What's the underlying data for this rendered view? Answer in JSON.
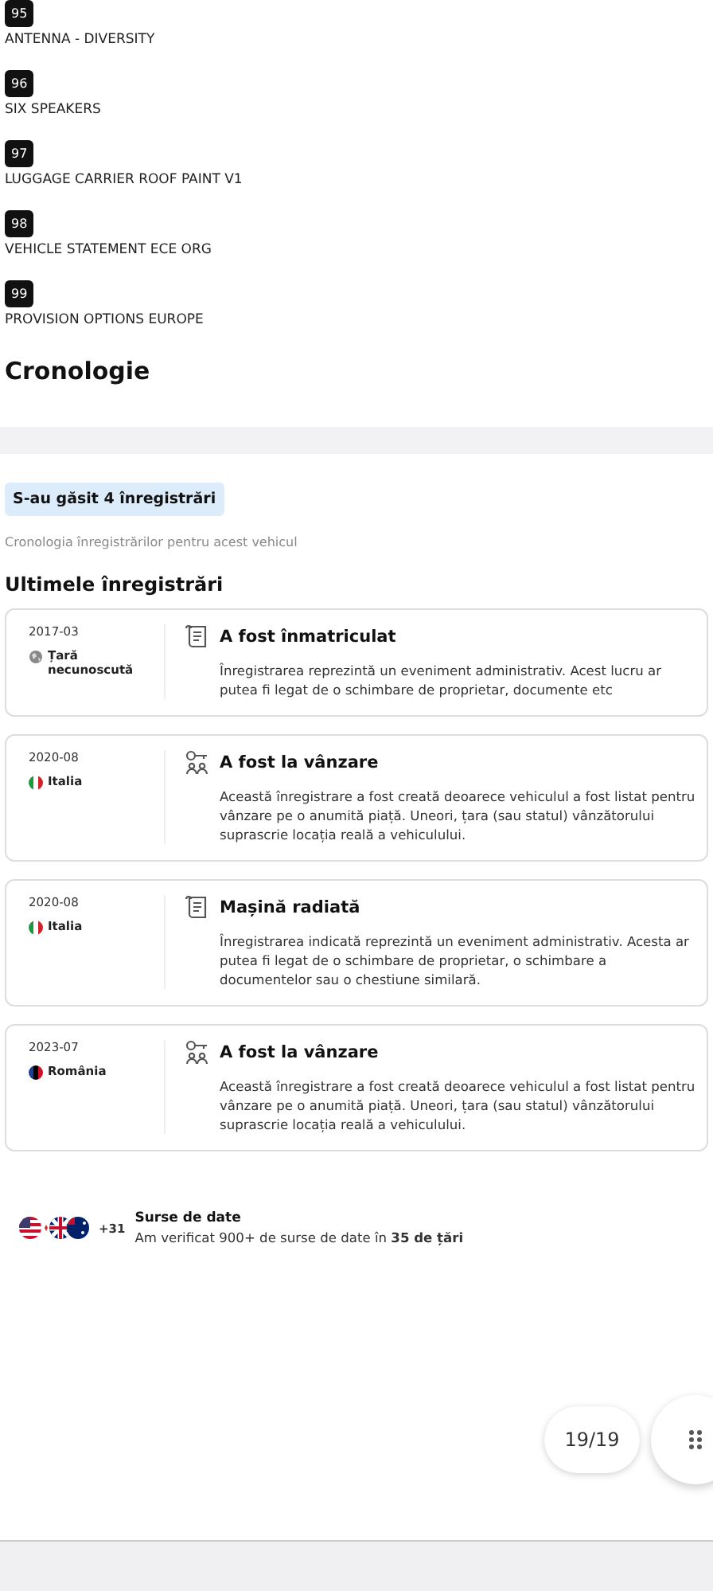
{
  "options": [
    {
      "number": "95",
      "label": "ANTENNA - DIVERSITY"
    },
    {
      "number": "96",
      "label": "SIX SPEAKERS"
    },
    {
      "number": "97",
      "label": "LUGGAGE CARRIER ROOF PAINT V1"
    },
    {
      "number": "98",
      "label": "VEHICLE STATEMENT ECE ORG"
    },
    {
      "number": "99",
      "label": "PROVISION OPTIONS EUROPE"
    }
  ],
  "section_title": "Cronologie",
  "timeline": {
    "found_badge": "S-au găsit 4 înregistrări",
    "subtitle": "Cronologia înregistrărilor pentru acest vehicul",
    "heading": "Ultimele înregistrări",
    "events": [
      {
        "date": "2017-03",
        "country": {
          "name": "Țară necunoscută",
          "kind": "unknown"
        },
        "kind": "document",
        "title": "A fost înmatriculat",
        "description": "Înregistrarea reprezintă un eveniment administrativ. Acest lucru ar putea fi legat de o schimbare de proprietar, documente etc"
      },
      {
        "date": "2020-08",
        "country": {
          "name": "Italia",
          "kind": "italy"
        },
        "kind": "sale",
        "title": "A fost la vânzare",
        "description": "Această înregistrare a fost creată deoarece vehiculul a fost listat pentru vânzare pe o anumită piață. Uneori, țara (sau statul) vânzătorului suprascrie locația reală a vehiculului."
      },
      {
        "date": "2020-08",
        "country": {
          "name": "Italia",
          "kind": "italy"
        },
        "kind": "document",
        "title": "Mașină radiată",
        "description": "Înregistrarea indicată reprezintă un eveniment administrativ. Acesta ar putea fi legat de o schimbare de proprietar, o schimbare a documentelor sau o chestiune similară."
      },
      {
        "date": "2023-07",
        "country": {
          "name": "România",
          "kind": "romania"
        },
        "kind": "sale",
        "title": "A fost la vânzare",
        "description": "Această înregistrare a fost creată deoarece vehiculul a fost listat pentru vânzare pe o anumită piață. Uneori, țara (sau statul) vânzătorului suprascrie locația reală a vehiculului."
      }
    ]
  },
  "sources": {
    "extra_count": "+31",
    "title": "Surse de date",
    "text": "Am verificat 900+ de surse de date în **35 de țări**"
  },
  "pager": {
    "label": "19/19"
  }
}
